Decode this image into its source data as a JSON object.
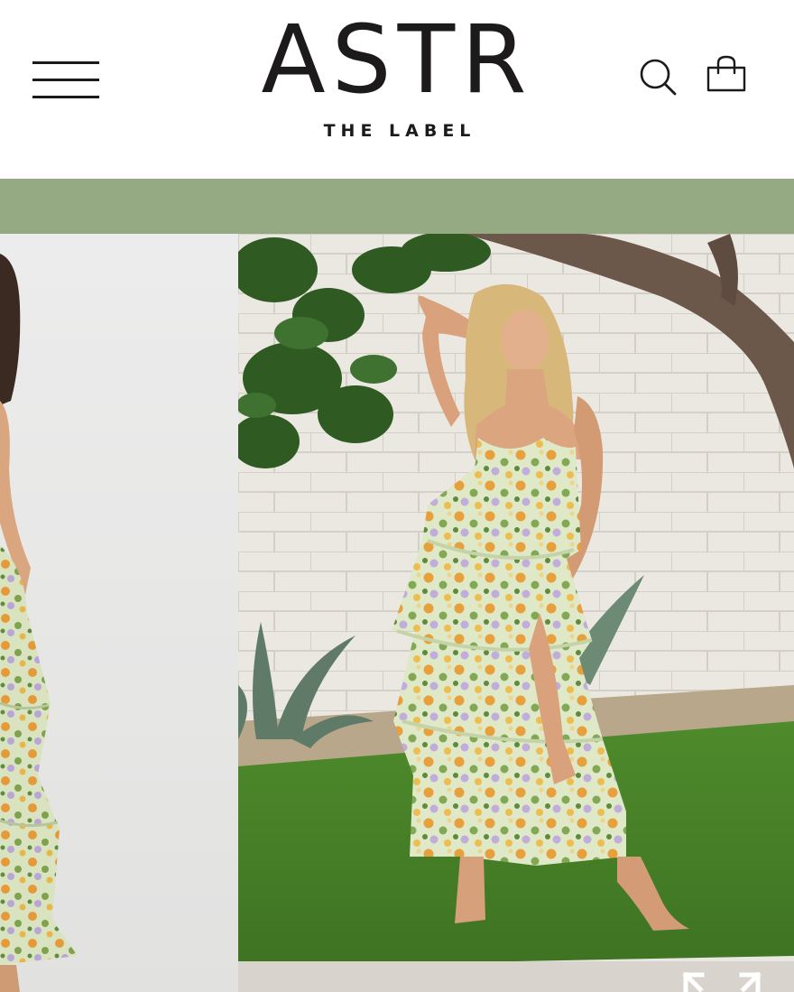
{
  "header": {
    "brand_name": "ASTR",
    "brand_tagline": "THE LABEL",
    "menu_icon": "hamburger-menu-icon",
    "search_icon": "search-icon",
    "cart_icon": "shopping-bag-icon"
  },
  "announcement_bar": {
    "text": "",
    "color": "#95aa82"
  },
  "gallery": {
    "images": [
      {
        "label": "product-photo-studio",
        "background": "#e8e8e7"
      },
      {
        "label": "product-photo-garden",
        "background": "#e9e7e2"
      }
    ],
    "expand_icon": "expand-arrows-icon"
  },
  "colors": {
    "text": "#1c1a1b",
    "accent_green": "#95aa82",
    "background": "#ffffff"
  }
}
